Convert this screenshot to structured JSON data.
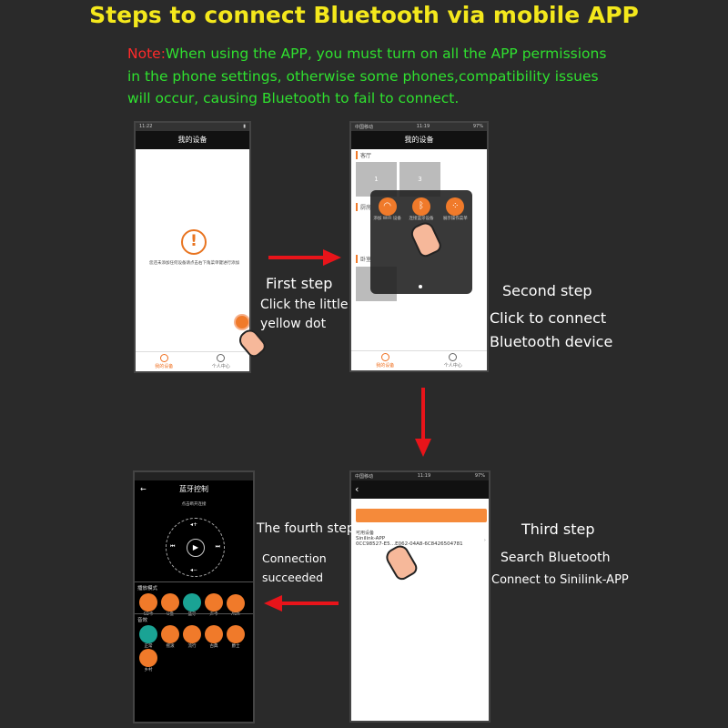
{
  "title": "Steps to connect Bluetooth via mobile APP",
  "note": {
    "prefix": "Note:",
    "line1": "When using the APP, you must turn on all the APP permissions",
    "line2": "in the phone settings, otherwise some phones,compatibility issues",
    "line3": "will occur, causing Bluetooth to fail to connect."
  },
  "steps": {
    "first": {
      "title": "First step",
      "line1": "Click the little",
      "line2": "yellow dot"
    },
    "second": {
      "title": "Second step",
      "line1": "Click to connect",
      "line2": "Bluetooth device"
    },
    "third": {
      "title": "Third step",
      "line1": "Search Bluetooth",
      "line2": "Connect to Sinilink-APP"
    },
    "fourth": {
      "title": "The fourth step",
      "line1": "Connection",
      "line2": "succeeded"
    }
  },
  "phone1": {
    "status_time": "11:22",
    "header": "我的设备",
    "empty_msg": "您还未添加任何设备请点击右下角菜单键进行添加",
    "tab_devices": "我的设备",
    "tab_profile": "个人中心"
  },
  "phone2": {
    "status_carrier": "中国移动",
    "status_time": "11:19",
    "status_battery": "97%",
    "header": "我的设备",
    "room1": "客厅",
    "room2": "厨房",
    "room3": "卧室",
    "tile1": "1",
    "tile2": "3",
    "menu_wifi": "添加 WIFI 设备",
    "menu_bt": "连接蓝牙设备",
    "menu_ops": "展示操作菜单",
    "tab_devices": "我的设备",
    "tab_profile": "个人中心"
  },
  "phone3": {
    "status_carrier": "中国移动",
    "status_time": "11:19",
    "status_battery": "97%",
    "section": "可用设备",
    "device_name": "Sinilink-APP",
    "device_id": "0CC98527-E5…E062-04A8-6C8426504781"
  },
  "phone4": {
    "header": "蓝牙控制",
    "hint": "点击断开连接",
    "play_mode": "播放模式",
    "modes": [
      "SD卡",
      "U盘",
      "蓝牙",
      "声卡",
      "AUX"
    ],
    "effects_label": "音效",
    "effects": [
      "正常",
      "摇滚",
      "流行",
      "古典",
      "爵士",
      "乡村"
    ]
  },
  "colors": {
    "title": "#f4e81c",
    "note": "#2fe02f",
    "note_prefix": "#ff2a2a",
    "arrow": "#e8141a",
    "accent": "#f07a2a",
    "active_mode": "#1aa394"
  }
}
